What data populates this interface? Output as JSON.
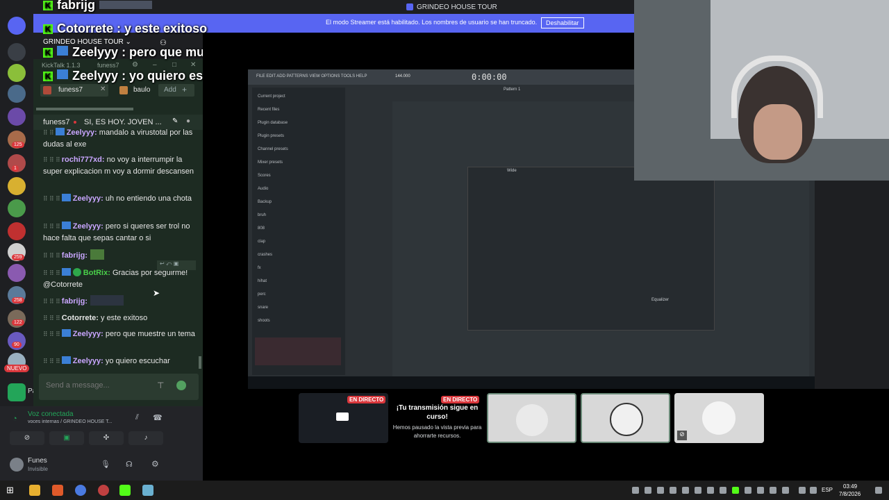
{
  "discord": {
    "server_badges": [
      "125",
      "1",
      "259",
      "258",
      "122",
      "90"
    ],
    "new_label": "NUEVO",
    "streamer_message": "El modo Streamer está habilitado. Los nombres de usuario se han truncado.",
    "streamer_button": "Deshabilitar",
    "server_name": "GRINDEO HOUSE TOUR",
    "voice_status": "Voz conectada",
    "voice_channel": "voces internas / GRINDEO HOUSE T...",
    "user_name": "Funes",
    "user_status": "Invisible",
    "partial_label": "Pa"
  },
  "stream": {
    "window_title": "GRINDEO HOUSE TOUR",
    "overlay_messages": [
      {
        "user": "fabrijg",
        "text": ""
      },
      {
        "user": "Cotorrete",
        "text": " : y este exitoso"
      },
      {
        "user": "Zeelyyy",
        "text": " : pero que muestre un tema"
      },
      {
        "user": "Zeelyyy",
        "text": " : yo quiero escuchar"
      }
    ],
    "live_badge_1": "EN DIRECTO",
    "live_badge_2": "EN DIRECTO",
    "paused_title": "¡Tu transmisión sigue en curso!",
    "paused_text": "Hemos pausado la vista previa para ahorrarte recursos."
  },
  "kicktalk": {
    "app_label": "KickTalk 1.1.3",
    "chat_tab": "funess7",
    "tabs": [
      "funess7",
      "baulo"
    ],
    "add_label": "Add",
    "pinned_user": "funess7",
    "pinned_text": "SI, ES HOY. JOVEN ...",
    "messages": [
      {
        "user": "Zeelyyy:",
        "text": " mandalo a virustotal por las dudas al exe"
      },
      {
        "user": "rochi777xd:",
        "text": " no voy a interrumpir la super explicacion m voy a dormir descansen"
      },
      {
        "user": "Zeelyyy:",
        "text": " uh no entiendo una chota"
      },
      {
        "user": "Zeelyyy:",
        "text": " pero si queres ser trol no hace falta que sepas cantar o si"
      },
      {
        "user": "fabrijg:",
        "text": ""
      },
      {
        "user": "BotRix:",
        "text": " Gracias por seguirme! @Cotorrete"
      },
      {
        "user": "fabrijg:",
        "text": ""
      },
      {
        "user": "Cotorrete:",
        "text": " y este exitoso"
      },
      {
        "user": "Zeelyyy:",
        "text": " pero que muestre un tema"
      },
      {
        "user": "Zeelyyy:",
        "text": " yo quiero escuchar"
      }
    ],
    "send_placeholder": "Send a message..."
  },
  "fl_studio": {
    "menu": "FILE EDIT ADD PATTERNS VIEW OPTIONS TOOLS HELP",
    "time": "0:00:00",
    "tempo": "144.000",
    "browser_items": [
      "Current project",
      "Recent files",
      "Plugin database",
      "Plugin presets",
      "Channel presets",
      "Mixer presets",
      "Scores",
      "Audio",
      "Backup",
      "bruh",
      "808",
      "clap",
      "crashes",
      "fx",
      "hihat",
      "perc",
      "snare",
      "shoots"
    ],
    "pattern": "Pattern 1",
    "mixer_title": "Wide",
    "equalizer": "Equalizer"
  },
  "taskbar": {
    "lang": "ESP",
    "time": "03:49",
    "date": "7/8/2026"
  }
}
